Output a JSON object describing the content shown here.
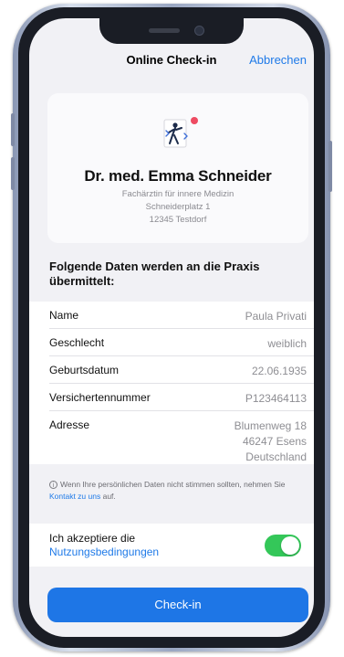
{
  "navbar": {
    "title": "Online Check-in",
    "cancel_label": "Abbrechen"
  },
  "doctor": {
    "logo_icon": "doctor-figure-logo-icon",
    "name": "Dr. med. Emma Schneider",
    "specialty": "Fachärztin für innere Medizin",
    "street": "Schneiderplatz 1",
    "city": "12345 Testdorf"
  },
  "section_title": "Folgende Daten werden an die Praxis übermittelt:",
  "data_rows": [
    {
      "label": "Name",
      "value": "Paula Privati"
    },
    {
      "label": "Geschlecht",
      "value": "weiblich"
    },
    {
      "label": "Geburtsdatum",
      "value": "22.06.1935"
    },
    {
      "label": "Versichertennummer",
      "value": "P123464113"
    },
    {
      "label": "Adresse",
      "value_lines": [
        "Blumenweg 18",
        "46247 Esens",
        "Deutschland"
      ]
    }
  ],
  "info": {
    "icon": "info-icon",
    "text_before": "Wenn Ihre persönlichen Daten nicht stimmen sollten, nehmen Sie ",
    "link": "Kontakt zu uns",
    "text_after": " auf."
  },
  "terms": {
    "text": "Ich akzeptiere die",
    "link": "Nutzungsbedingungen",
    "accepted": true
  },
  "checkin_button": "Check-in",
  "colors": {
    "accent": "#1e76e6",
    "toggle_on": "#34c759",
    "logo_dot": "#ee4b62"
  }
}
